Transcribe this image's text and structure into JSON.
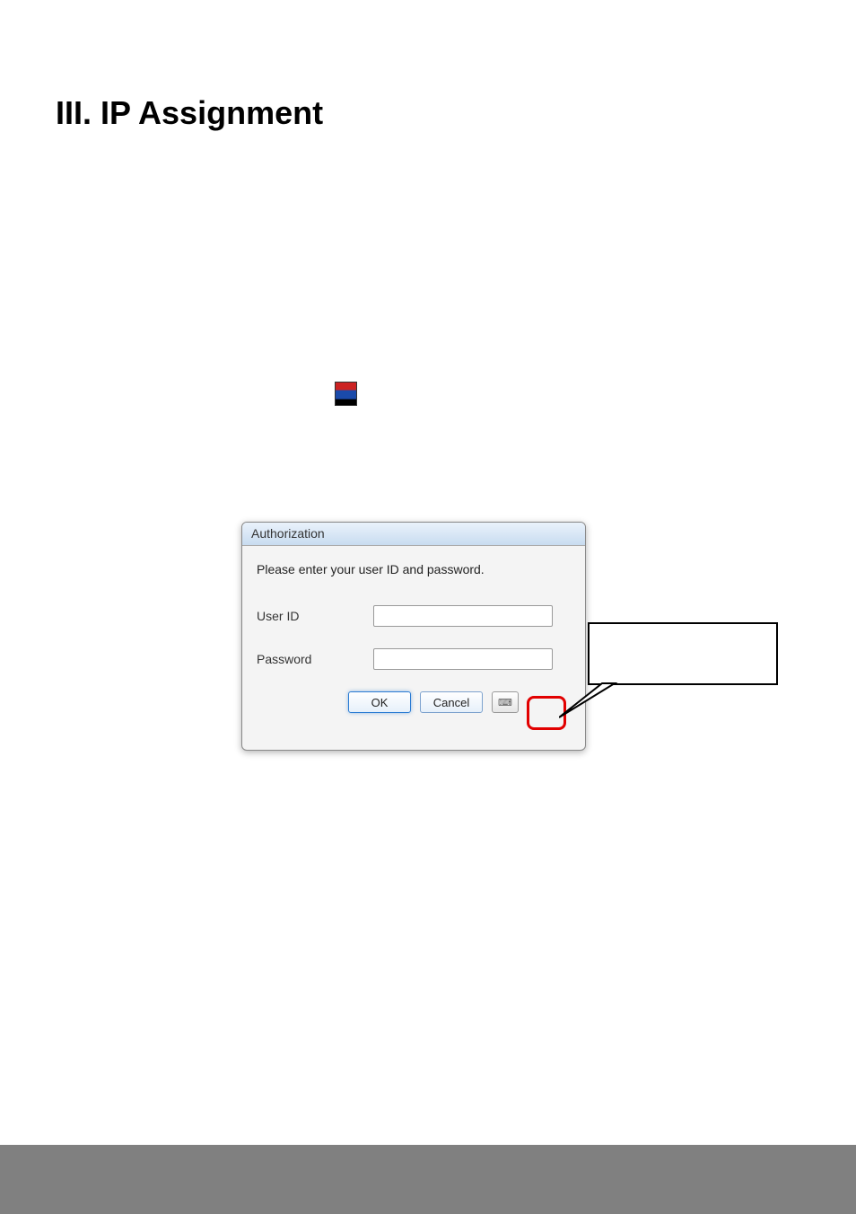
{
  "heading": "III.  IP Assignment",
  "dialog": {
    "title": "Authorization",
    "message": "Please enter your user ID and password.",
    "user_label": "User ID",
    "user_value": "",
    "pass_label": "Password",
    "pass_value": "",
    "ok_label": "OK",
    "cancel_label": "Cancel"
  }
}
